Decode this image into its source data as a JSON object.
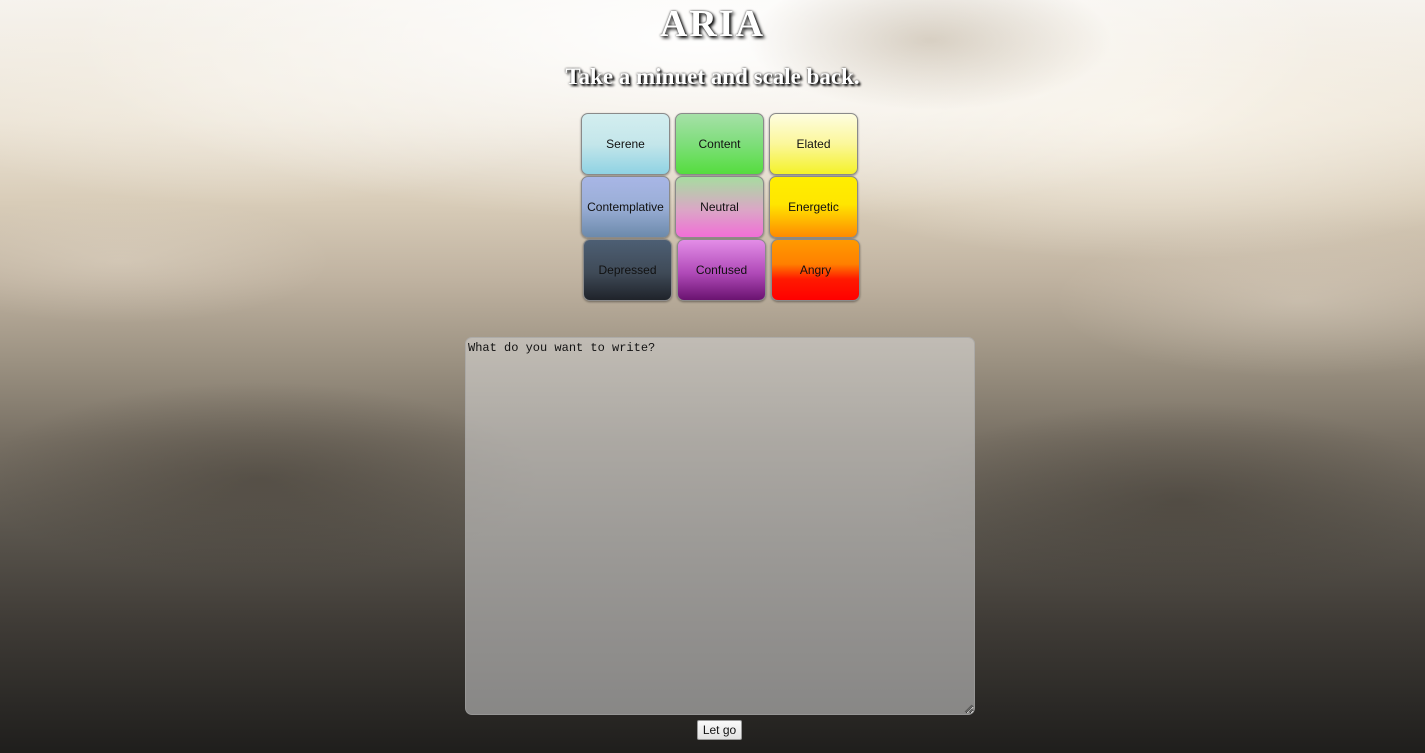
{
  "header": {
    "title": "ARIA",
    "subtitle": "Take a minuet and scale back."
  },
  "moods": [
    {
      "label": "Serene",
      "colors": [
        "#d3eef0",
        "#8fd2e3"
      ]
    },
    {
      "label": "Content",
      "colors": [
        "#a6e0a8",
        "#55dd3e"
      ]
    },
    {
      "label": "Elated",
      "colors": [
        "#fefde0",
        "#f4f229"
      ]
    },
    {
      "label": "Contemplative",
      "colors": [
        "#a8b6e6",
        "#6c8aab"
      ]
    },
    {
      "label": "Neutral",
      "colors": [
        "#a7dca0",
        "#f06fd6"
      ]
    },
    {
      "label": "Energetic",
      "colors": [
        "#ffee00",
        "#ff8a00"
      ]
    },
    {
      "label": "Depressed",
      "colors": [
        "#4d5f74",
        "#1f232a"
      ]
    },
    {
      "label": "Confused",
      "colors": [
        "#e38de7",
        "#6a1370"
      ]
    },
    {
      "label": "Angry",
      "colors": [
        "#ff9a00",
        "#ff0000"
      ]
    }
  ],
  "editor": {
    "placeholder": "What do you want to write?",
    "value": ""
  },
  "submit": {
    "label": "Let go"
  }
}
